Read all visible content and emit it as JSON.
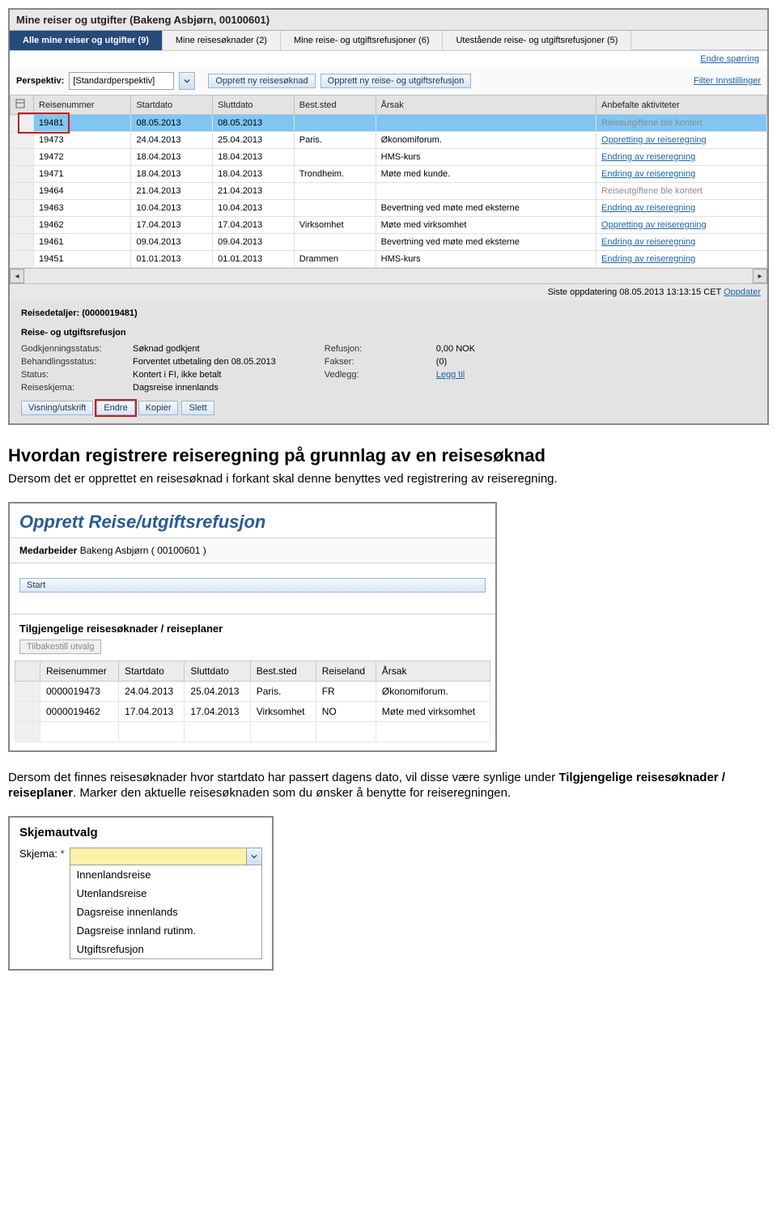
{
  "window_title": "Mine reiser og utgifter (Bakeng Asbjørn, 00100601)",
  "tabs": [
    "Alle mine reiser og utgifter (9)",
    "Mine reisesøknader (2)",
    "Mine reise- og utgiftsrefusjoner (6)",
    "Utestående reise- og utgiftsrefusjoner (5)"
  ],
  "link_endre_sporring": "Endre spørring",
  "perspektiv_label": "Perspektiv:",
  "perspektiv_value": "[Standardperspektiv]",
  "btn_opprett_soknad": "Opprett ny reisesøknad",
  "btn_opprett_refusjon": "Opprett ny reise- og utgiftsrefusjon",
  "link_filter": "Filter Innstillinger",
  "grid_headers": [
    "Reisenummer",
    "Startdato",
    "Sluttdato",
    "Best.sted",
    "Årsak",
    "Anbefalte aktiviteter"
  ],
  "grid_rows": [
    {
      "n": "19481",
      "sd": "08.05.2013",
      "ed": "08.05.2013",
      "bs": "",
      "reason": "",
      "act": "Reiseutgiftene ble kontert",
      "selected": true,
      "gray": true
    },
    {
      "n": "19473",
      "sd": "24.04.2013",
      "ed": "25.04.2013",
      "bs": "Paris.",
      "reason": "Økonomiforum.",
      "act": "Oppretting av reiseregning"
    },
    {
      "n": "19472",
      "sd": "18.04.2013",
      "ed": "18.04.2013",
      "bs": "",
      "reason": "HMS-kurs",
      "act": "Endring av reiseregning"
    },
    {
      "n": "19471",
      "sd": "18.04.2013",
      "ed": "18.04.2013",
      "bs": "Trondheim.",
      "reason": "Møte med kunde.",
      "act": "Endring av reiseregning"
    },
    {
      "n": "19464",
      "sd": "21.04.2013",
      "ed": "21.04.2013",
      "bs": "",
      "reason": "",
      "act": "Reiseutgiftene ble kontert",
      "gray": true
    },
    {
      "n": "19463",
      "sd": "10.04.2013",
      "ed": "10.04.2013",
      "bs": "",
      "reason": "Bevertning ved møte med eksterne",
      "act": "Endring av reiseregning"
    },
    {
      "n": "19462",
      "sd": "17.04.2013",
      "ed": "17.04.2013",
      "bs": "Virksomhet",
      "reason": "Møte med virksomhet",
      "act": "Oppretting av reiseregning"
    },
    {
      "n": "19461",
      "sd": "09.04.2013",
      "ed": "09.04.2013",
      "bs": "",
      "reason": "Bevertning ved møte med eksterne",
      "act": "Endring av reiseregning"
    },
    {
      "n": "19451",
      "sd": "01.01.2013",
      "ed": "01.01.2013",
      "bs": "Drammen",
      "reason": "HMS-kurs",
      "act": "Endring av reiseregning"
    }
  ],
  "footer_update": "Siste oppdatering 08.05.2013 13:13:15 CET",
  "footer_update_link": "Oppdater",
  "details_title": "Reisedetaljer: (0000019481)",
  "details_subtitle": "Reise- og utgiftsrefusjon",
  "details_left": [
    {
      "k": "Godkjenningsstatus:",
      "v": "Søknad godkjent"
    },
    {
      "k": "Behandlingsstatus:",
      "v": "Forventet utbetaling den 08.05.2013"
    },
    {
      "k": "Status:",
      "v": "Kontert i FI, ikke betalt"
    },
    {
      "k": "Reiseskjema:",
      "v": "Dagsreise innenlands"
    }
  ],
  "details_right": [
    {
      "k": "Refusjon:",
      "v": "0,00 NOK"
    },
    {
      "k": "Fakser:",
      "v": "(0)"
    },
    {
      "k": "Vedlegg:",
      "v": "Legg til",
      "link": true
    }
  ],
  "detail_buttons": [
    "Visning/utskrift",
    "Endre",
    "Kopier",
    "Slett"
  ],
  "doc_heading": "Hvordan registrere reiseregning på grunnlag av en reisesøknad",
  "doc_p1": "Dersom det er opprettet en reisesøknad i forkant skal denne benyttes ved registrering av reiseregning.",
  "s2_title": "Opprett Reise/utgiftsrefusjon",
  "s2_medarb_label": "Medarbeider",
  "s2_medarb_value": "Bakeng Asbjørn ( 00100601 )",
  "s2_start": "Start",
  "s2_section": "Tilgjengelige reisesøknader / reiseplaner",
  "s2_reset": "Tilbakestill utvalg",
  "s2_headers": [
    "Reisenummer",
    "Startdato",
    "Sluttdato",
    "Best.sted",
    "Reiseland",
    "Årsak"
  ],
  "s2_rows": [
    {
      "n": "0000019473",
      "sd": "24.04.2013",
      "ed": "25.04.2013",
      "bs": "Paris.",
      "land": "FR",
      "reason": "Økonomiforum."
    },
    {
      "n": "0000019462",
      "sd": "17.04.2013",
      "ed": "17.04.2013",
      "bs": "Virksomhet",
      "land": "NO",
      "reason": "Møte med virksomhet"
    }
  ],
  "doc_p2a": "Dersom det finnes reisesøknader hvor startdato har passert dagens dato, vil disse være synlige under ",
  "doc_p2b": "Tilgjengelige reisesøknader / reiseplaner",
  "doc_p2c": ". Marker den aktuelle reisesøknaden som du ønsker å benytte for reiseregningen.",
  "skj_title": "Skjemautvalg",
  "skj_label": "Skjema:",
  "skj_options": [
    "Innenlandsreise",
    "Utenlandsreise",
    "Dagsreise innenlands",
    "Dagsreise innland rutinm.",
    "Utgiftsrefusjon"
  ]
}
